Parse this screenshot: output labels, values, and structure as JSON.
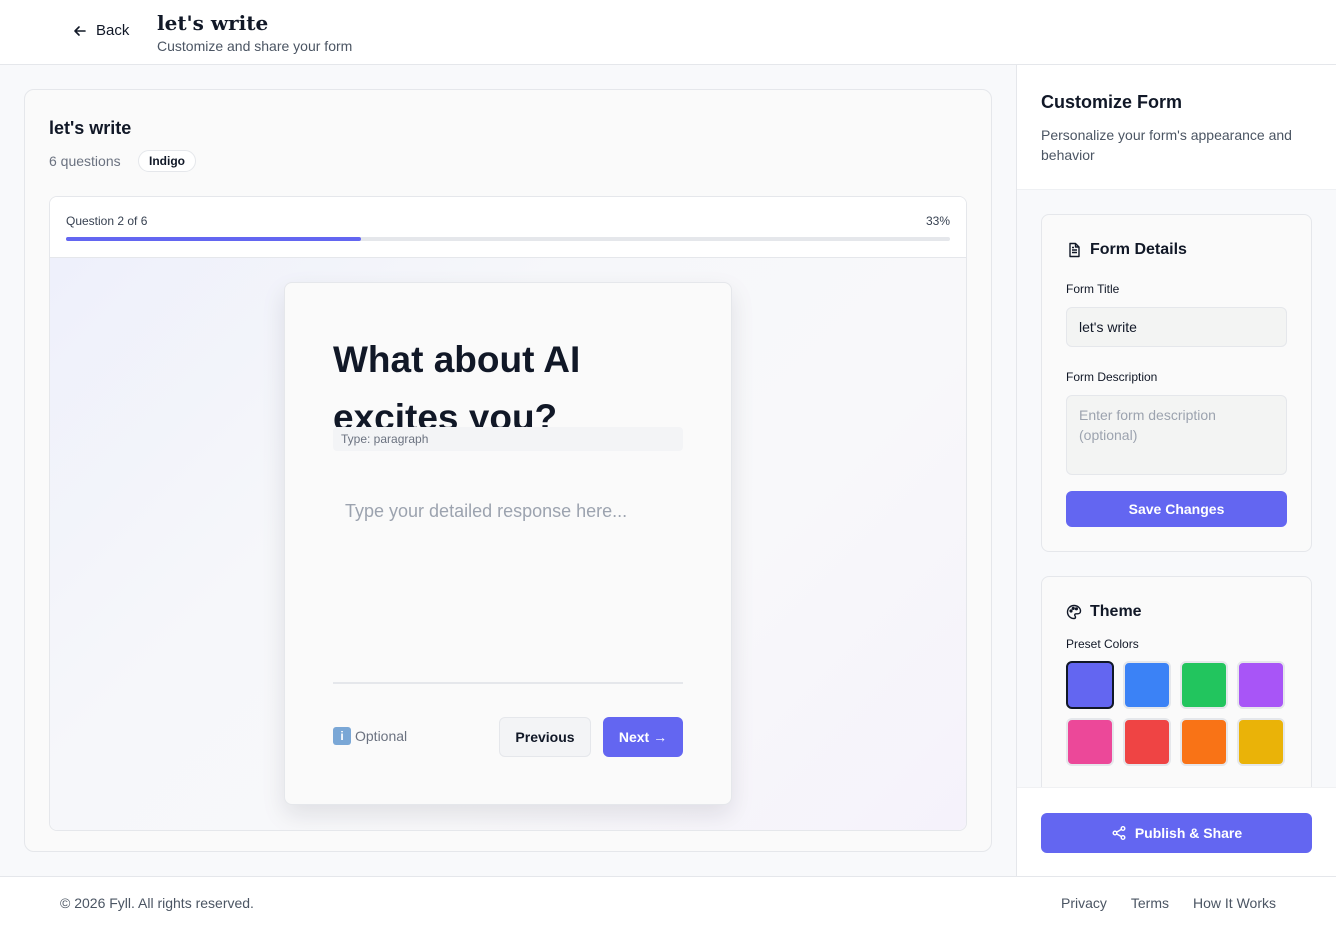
{
  "header": {
    "back_label": "Back",
    "title": "let's write",
    "subtitle": "Customize and share your form"
  },
  "preview": {
    "form_name": "let's write",
    "question_count": "6 questions",
    "theme_badge": "Indigo",
    "progress_label": "Question 2 of 6",
    "progress_percent_label": "33%",
    "progress_value": 0.3333,
    "question_title": "What about AI excites you?",
    "question_type": "Type: paragraph",
    "answer_placeholder": "Type your detailed response here...",
    "optional_label": "Optional",
    "optional_icon": "info-icon",
    "previous_label": "Previous",
    "next_label": "Next →"
  },
  "sidebar": {
    "title": "Customize Form",
    "description": "Personalize your form's appearance and behavior",
    "details": {
      "heading": "Form Details",
      "heading_icon": "document-icon",
      "title_label": "Form Title",
      "title_value": "let's write",
      "description_label": "Form Description",
      "description_placeholder": "Enter form description (optional)",
      "save_label": "Save Changes"
    },
    "theme": {
      "heading": "Theme",
      "heading_icon": "palette-icon",
      "preset_label": "Preset Colors",
      "presets": [
        {
          "color": "#6366f1",
          "selected": true
        },
        {
          "color": "#3b82f6",
          "selected": false
        },
        {
          "color": "#22c55e",
          "selected": false
        },
        {
          "color": "#a855f7",
          "selected": false
        },
        {
          "color": "#ec4899",
          "selected": false
        },
        {
          "color": "#ef4444",
          "selected": false
        },
        {
          "color": "#f97316",
          "selected": false
        },
        {
          "color": "#eab308",
          "selected": false
        }
      ]
    },
    "publish_label": "Publish & Share",
    "publish_icon": "share-icon"
  },
  "footer": {
    "copyright": "© 2026 Fyll. All rights reserved.",
    "links": [
      "Privacy",
      "Terms",
      "How It Works"
    ]
  },
  "colors": {
    "accent": "#6366f1",
    "border": "#e5e7eb",
    "text": "#111827",
    "muted": "#6b7280"
  }
}
